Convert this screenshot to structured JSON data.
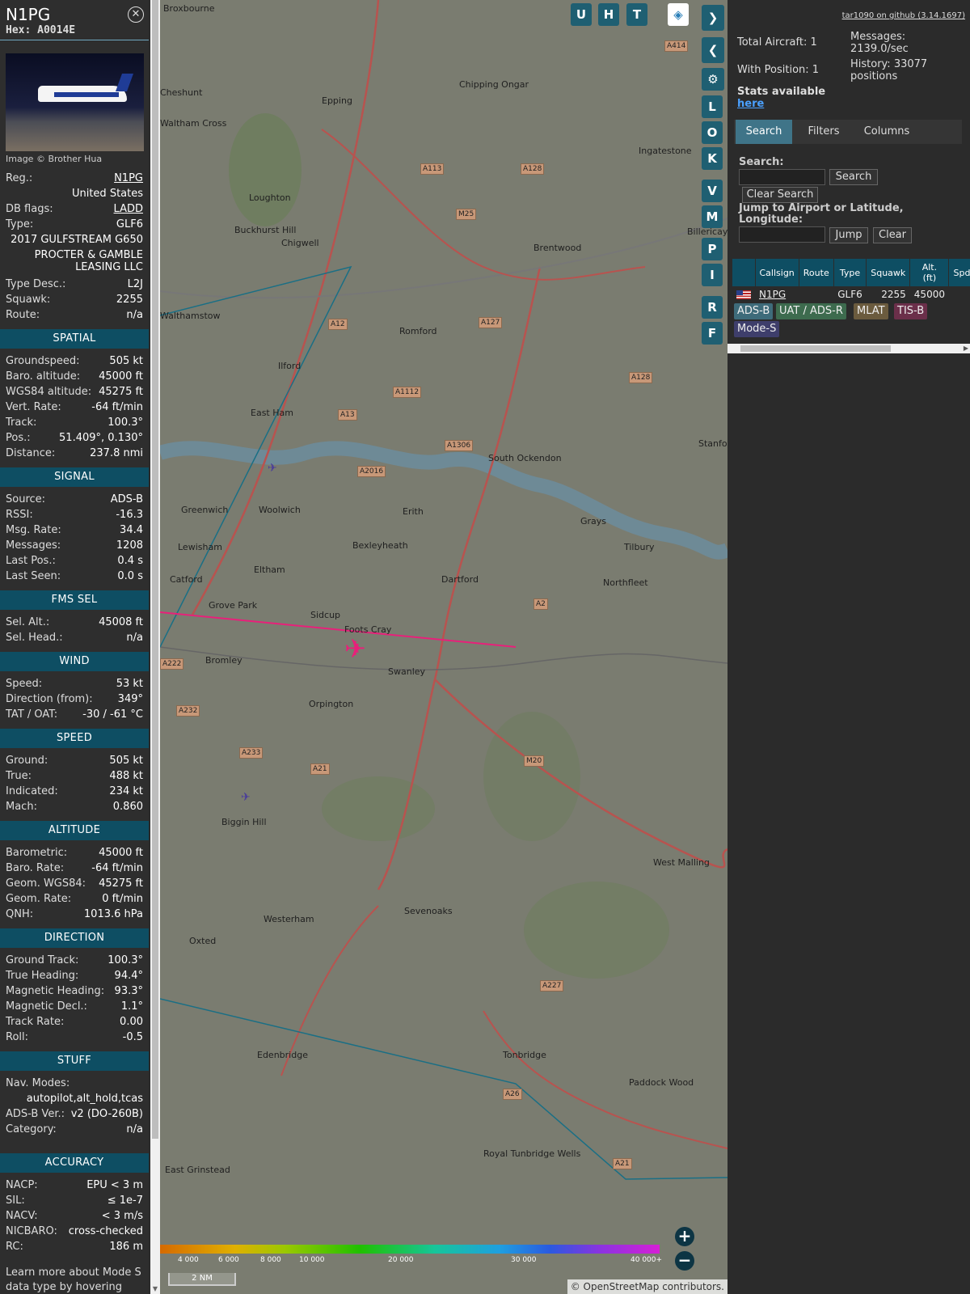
{
  "aircraft": {
    "callsign": "N1PG",
    "hex_label": "Hex: A0014E",
    "image_caption": "Image © Brother Hua",
    "reg_label": "Reg.:",
    "reg": "N1PG",
    "country": "United States",
    "dbflags_label": "DB flags:",
    "dbflags": "LADD",
    "type_label": "Type:",
    "type": "GLF6",
    "model": "2017 GULFSTREAM G650",
    "owner": "PROCTER & GAMBLE LEASING LLC",
    "typedesc_label": "Type Desc.:",
    "typedesc": "L2J",
    "squawk_label": "Squawk:",
    "squawk": "2255",
    "route_label": "Route:",
    "route": "n/a"
  },
  "sections": {
    "spatial": {
      "title": "SPATIAL",
      "rows": [
        {
          "k": "Groundspeed:",
          "v": "505 kt"
        },
        {
          "k": "Baro. altitude:",
          "v": "45000 ft"
        },
        {
          "k": "WGS84 altitude:",
          "v": "45275 ft"
        },
        {
          "k": "Vert. Rate:",
          "v": "-64 ft/min"
        },
        {
          "k": "Track:",
          "v": "100.3°"
        },
        {
          "k": "Pos.:",
          "v": "51.409°, 0.130°"
        },
        {
          "k": "Distance:",
          "v": "237.8 nmi"
        }
      ]
    },
    "signal": {
      "title": "SIGNAL",
      "rows": [
        {
          "k": "Source:",
          "v": "ADS-B"
        },
        {
          "k": "RSSI:",
          "v": "-16.3"
        },
        {
          "k": "Msg. Rate:",
          "v": "34.4"
        },
        {
          "k": "Messages:",
          "v": "1208"
        },
        {
          "k": "Last Pos.:",
          "v": "0.4 s"
        },
        {
          "k": "Last Seen:",
          "v": "0.0 s"
        }
      ]
    },
    "fms": {
      "title": "FMS SEL",
      "rows": [
        {
          "k": "Sel. Alt.:",
          "v": "45008 ft"
        },
        {
          "k": "Sel. Head.:",
          "v": "n/a"
        }
      ]
    },
    "wind": {
      "title": "WIND",
      "rows": [
        {
          "k": "Speed:",
          "v": "53 kt"
        },
        {
          "k": "Direction (from):",
          "v": "349°"
        },
        {
          "k": "TAT / OAT:",
          "v": "-30 / -61 °C"
        }
      ]
    },
    "speed": {
      "title": "SPEED",
      "rows": [
        {
          "k": "Ground:",
          "v": "505 kt"
        },
        {
          "k": "True:",
          "v": "488 kt"
        },
        {
          "k": "Indicated:",
          "v": "234 kt"
        },
        {
          "k": "Mach:",
          "v": "0.860"
        }
      ]
    },
    "altitude": {
      "title": "ALTITUDE",
      "rows": [
        {
          "k": "Barometric:",
          "v": "45000 ft"
        },
        {
          "k": "Baro. Rate:",
          "v": "-64 ft/min"
        },
        {
          "k": "Geom. WGS84:",
          "v": "45275 ft"
        },
        {
          "k": "Geom. Rate:",
          "v": "0 ft/min"
        },
        {
          "k": "QNH:",
          "v": "1013.6 hPa"
        }
      ]
    },
    "direction": {
      "title": "DIRECTION",
      "rows": [
        {
          "k": "Ground Track:",
          "v": "100.3°"
        },
        {
          "k": "True Heading:",
          "v": "94.4°"
        },
        {
          "k": "Magnetic Heading:",
          "v": "93.3°"
        },
        {
          "k": "Magnetic Decl.:",
          "v": "1.1°"
        },
        {
          "k": "Track Rate:",
          "v": "0.00"
        },
        {
          "k": "Roll:",
          "v": "-0.5"
        }
      ]
    },
    "stuff": {
      "title": "STUFF",
      "navmodes_label": "Nav. Modes:",
      "navmodes": "autopilot,alt_hold,tcas",
      "rows": [
        {
          "k": "ADS-B Ver.:",
          "v": "v2 (DO-260B)"
        },
        {
          "k": "Category:",
          "v": "n/a"
        }
      ]
    },
    "accuracy": {
      "title": "ACCURACY",
      "rows": [
        {
          "k": "NACP:",
          "v": "EPU < 3 m"
        },
        {
          "k": "SIL:",
          "v": "≤ 1e-7"
        },
        {
          "k": "NACV:",
          "v": "< 3 m/s"
        },
        {
          "k": "NICBARO:",
          "v": "cross-checked"
        },
        {
          "k": "RC:",
          "v": "186 m"
        }
      ]
    },
    "footer_text": "Learn more about Mode S data type by hovering over"
  },
  "map": {
    "overlay_buttons_top": [
      "U",
      "H",
      "T"
    ],
    "side_buttons": [
      "L",
      "O",
      "K",
      "V",
      "M",
      "P",
      "I",
      "R",
      "F"
    ],
    "places": [
      "Broxbourne",
      "Chipping Ongar",
      "Cheshunt",
      "Epping",
      "Waltham Cross",
      "Loughton",
      "Ingatestone",
      "Buckhurst Hill",
      "Chigwell",
      "Billericay",
      "Brentwood",
      "Walthamstow",
      "Romford",
      "Ilford",
      "East Ham",
      "South Ockendon",
      "Stanford-le-Hope",
      "Greenwich",
      "Woolwich",
      "Erith",
      "Grays",
      "Lewisham",
      "Bexleyheath",
      "Tilbury",
      "Catford",
      "Eltham",
      "Dartford",
      "Northfleet",
      "Grove Park",
      "Sidcup",
      "Foots Cray",
      "Bromley",
      "Swanley",
      "Orpington",
      "Biggin Hill",
      "West Malling",
      "Westerham",
      "Sevenoaks",
      "Oxted",
      "Edenbridge",
      "Tonbridge",
      "Paddock Wood",
      "Royal Tunbridge Wells",
      "East Grinstead"
    ],
    "roads": [
      "A414",
      "A113",
      "A128",
      "M25",
      "A12",
      "A127",
      "A1112",
      "A13",
      "A1306",
      "A2016",
      "A128",
      "A2",
      "M20",
      "A21",
      "A232",
      "A233",
      "A227",
      "A26",
      "A21",
      "A222"
    ],
    "altitude_ticks": [
      "4 000",
      "6 000",
      "8 000",
      "10 000",
      "20 000",
      "30 000",
      "40 000+"
    ],
    "scale_label": "2 NM",
    "attribution": "© OpenStreetMap contributors."
  },
  "right": {
    "github_link": "tar1090 on github (3.14.1697)",
    "total_aircraft": "Total Aircraft: 1",
    "with_position": "With Position: 1",
    "messages_label": "Messages:",
    "messages_value": "2139.0/sec",
    "history_label": "History: 33077",
    "history_unit": "positions",
    "stats_label": "Stats available",
    "stats_link": "here",
    "tabs": [
      "Search",
      "Filters",
      "Columns"
    ],
    "search_label": "Search:",
    "search_button": "Search",
    "clear_search_button": "Clear Search",
    "jump_label": "Jump to Airport or Latitude, Longitude:",
    "jump_button": "Jump",
    "clear_button": "Clear",
    "table": {
      "headers": [
        "",
        "Callsign",
        "Route",
        "Type",
        "Squawk",
        "Alt. (ft)",
        "Spd."
      ],
      "row": {
        "callsign": "N1PG",
        "route": "",
        "type": "GLF6",
        "squawk": "2255",
        "alt": "45000",
        "spd": ""
      }
    },
    "badges": [
      "ADS-B",
      "UAT / ADS-R",
      "MLAT",
      "TIS-B",
      "Mode-S"
    ]
  }
}
